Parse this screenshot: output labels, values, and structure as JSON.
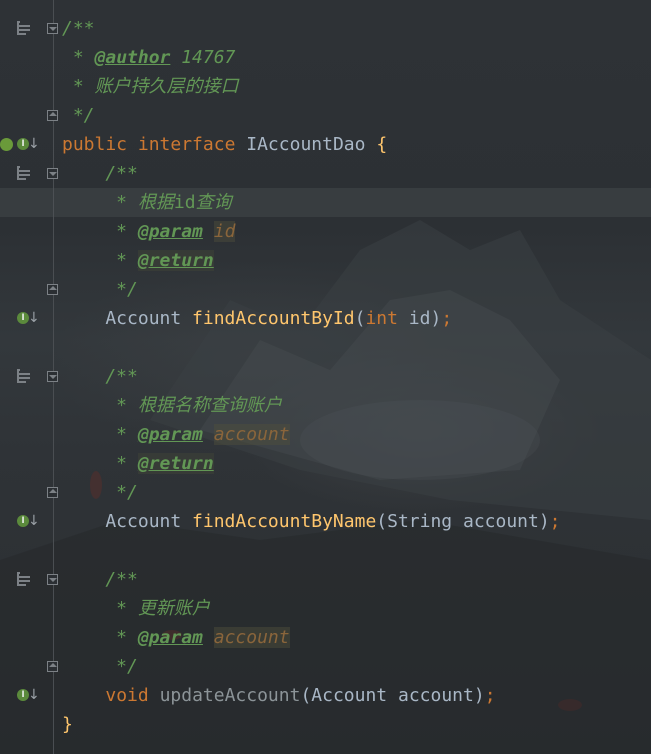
{
  "lines": [
    {
      "parts": [
        [
          "doc",
          "/**"
        ]
      ]
    },
    {
      "parts": [
        [
          "doc",
          " * "
        ],
        [
          "tag",
          "@author"
        ],
        [
          "doc",
          " 14767"
        ]
      ]
    },
    {
      "parts": [
        [
          "doc",
          " * 账户持久层的接口"
        ]
      ]
    },
    {
      "parts": [
        [
          "doc",
          " */"
        ]
      ]
    },
    {
      "parts": [
        [
          "kw",
          "public"
        ],
        [
          "plain",
          " "
        ],
        [
          "kw",
          "interface"
        ],
        [
          "plain",
          " IAccountDao "
        ],
        [
          "fn",
          "{"
        ]
      ]
    },
    {
      "parts": [
        [
          "doc",
          "    /**"
        ]
      ]
    },
    {
      "parts": [
        [
          "doc",
          "     * 根据"
        ],
        [
          "docplain",
          "id"
        ],
        [
          "doc",
          "查询"
        ]
      ]
    },
    {
      "parts": [
        [
          "doc",
          "     * "
        ],
        [
          "tag",
          "@param"
        ],
        [
          "doc",
          " "
        ],
        [
          "docval",
          "id"
        ]
      ]
    },
    {
      "parts": [
        [
          "doc",
          "     * "
        ],
        [
          "tagbox",
          "@return"
        ]
      ]
    },
    {
      "parts": [
        [
          "doc",
          "     */"
        ]
      ]
    },
    {
      "parts": [
        [
          "plain",
          "    Account "
        ],
        [
          "fn",
          "findAccountById"
        ],
        [
          "plain",
          "("
        ],
        [
          "kw",
          "int"
        ],
        [
          "plain",
          " id)"
        ],
        [
          "kw",
          ";"
        ]
      ]
    },
    {
      "parts": [
        [
          "plain",
          ""
        ]
      ]
    },
    {
      "parts": [
        [
          "doc",
          "    /**"
        ]
      ]
    },
    {
      "parts": [
        [
          "doc",
          "     * 根据名称查询账户"
        ]
      ]
    },
    {
      "parts": [
        [
          "doc",
          "     * "
        ],
        [
          "tag",
          "@param"
        ],
        [
          "doc",
          " "
        ],
        [
          "docval",
          "account"
        ]
      ]
    },
    {
      "parts": [
        [
          "doc",
          "     * "
        ],
        [
          "tagbox",
          "@return"
        ]
      ]
    },
    {
      "parts": [
        [
          "doc",
          "     */"
        ]
      ]
    },
    {
      "parts": [
        [
          "plain",
          "    Account "
        ],
        [
          "fn",
          "findAccountByName"
        ],
        [
          "plain",
          "(String account)"
        ],
        [
          "kw",
          ";"
        ]
      ]
    },
    {
      "parts": [
        [
          "plain",
          ""
        ]
      ]
    },
    {
      "parts": [
        [
          "doc",
          "    /**"
        ]
      ]
    },
    {
      "parts": [
        [
          "doc",
          "     * 更新账户"
        ]
      ]
    },
    {
      "parts": [
        [
          "doc",
          "     * "
        ],
        [
          "tag",
          "@param"
        ],
        [
          "doc",
          " "
        ],
        [
          "docval",
          "account"
        ]
      ]
    },
    {
      "parts": [
        [
          "doc",
          "     */"
        ]
      ]
    },
    {
      "parts": [
        [
          "plain",
          "    "
        ],
        [
          "kw",
          "void"
        ],
        [
          "plain",
          " "
        ],
        [
          "dim",
          "updateAccount"
        ],
        [
          "plain",
          "(Account account)"
        ],
        [
          "kw",
          ";"
        ]
      ]
    },
    {
      "parts": [
        [
          "fn",
          "}"
        ]
      ]
    }
  ],
  "gutter": {
    "doc_toggle_icon_name": "render-doc-icon",
    "fold_icon_name": "fold-icon",
    "implemented_icon_name": "implemented-by-icon"
  },
  "colors": {
    "keyword": "#cc7832",
    "function": "#ffc66d",
    "doc_comment": "#629755",
    "text": "#a9b7c6",
    "doc_param_value": "#8a653b"
  }
}
